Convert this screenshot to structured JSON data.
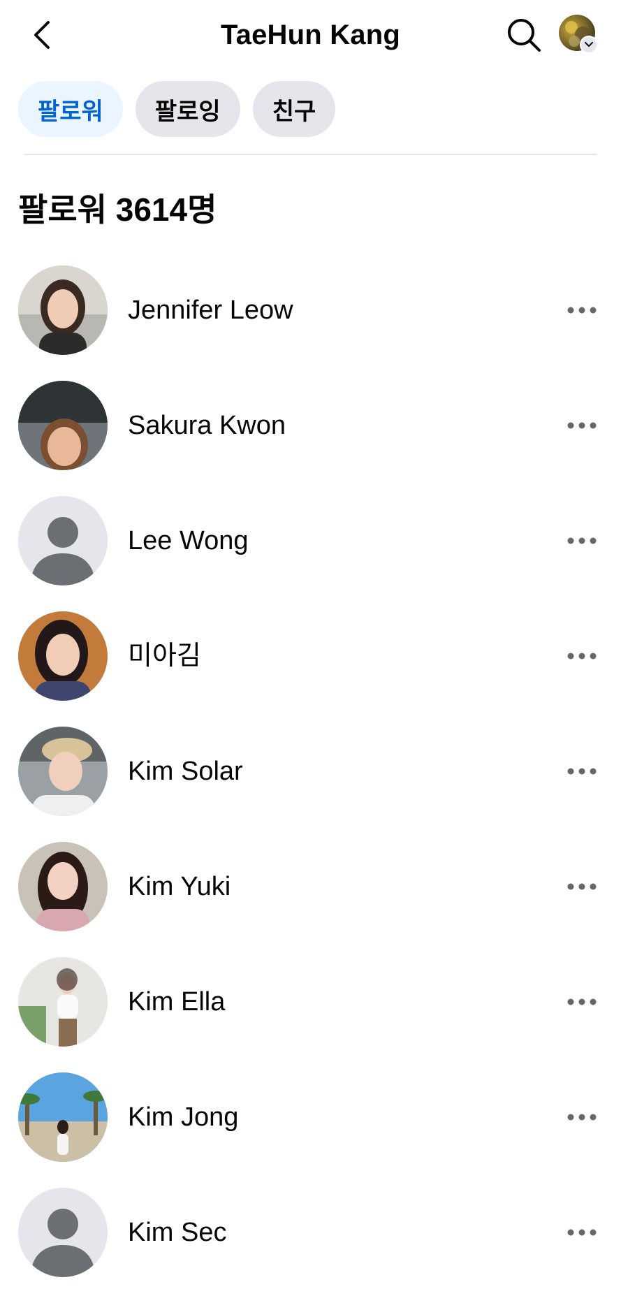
{
  "header": {
    "title": "TaeHun Kang",
    "back_icon": "back-arrow-icon",
    "search_icon": "search-icon",
    "profile_icon": "profile-avatar"
  },
  "tabs": [
    {
      "label": "팔로워",
      "active": true
    },
    {
      "label": "팔로잉",
      "active": false
    },
    {
      "label": "친구",
      "active": false
    }
  ],
  "section": {
    "title": "팔로워 3614명"
  },
  "followers": [
    {
      "name": "Jennifer Leow",
      "avatar": "photo"
    },
    {
      "name": "Sakura Kwon",
      "avatar": "photo"
    },
    {
      "name": "Lee Wong",
      "avatar": "default"
    },
    {
      "name": "미아김",
      "avatar": "photo"
    },
    {
      "name": "Kim Solar",
      "avatar": "photo"
    },
    {
      "name": "Kim Yuki",
      "avatar": "photo"
    },
    {
      "name": "Kim Ella",
      "avatar": "photo"
    },
    {
      "name": "Kim Jong",
      "avatar": "photo"
    },
    {
      "name": "Kim Sec",
      "avatar": "default"
    }
  ],
  "colors": {
    "accent": "#0064d1",
    "active_chip_bg": "#ebf5ff",
    "chip_bg": "#e4e6eb",
    "text": "#050505",
    "icon": "#65676b"
  }
}
